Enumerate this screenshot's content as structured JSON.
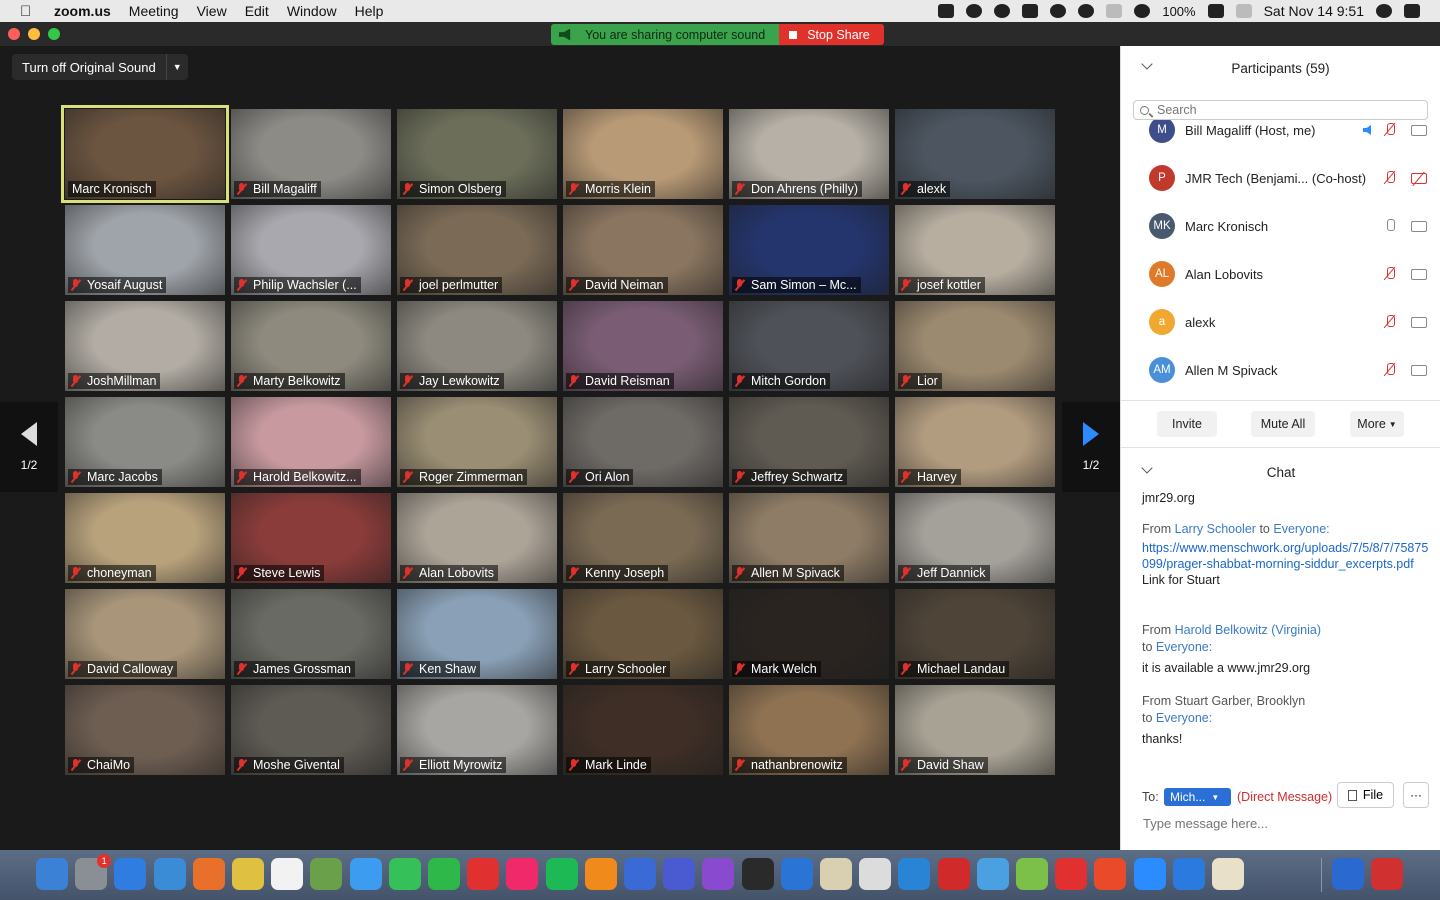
{
  "menubar": {
    "app": "zoom.us",
    "items": [
      "Meeting",
      "View",
      "Edit",
      "Window",
      "Help"
    ],
    "battery": "100%",
    "datetime": "Sat Nov 14  9:51"
  },
  "banner": {
    "sound": "You are sharing computer sound",
    "stop": "Stop Share"
  },
  "toolbar": {
    "original_sound": "Turn off Original Sound"
  },
  "pager": {
    "left": "1/2",
    "right": "1/2"
  },
  "tiles": [
    {
      "name": "Marc Kronisch",
      "muted": false,
      "active": true,
      "bg": "#6b5440"
    },
    {
      "name": "Bill Magaliff",
      "muted": true,
      "bg": "#8d8b86"
    },
    {
      "name": "Simon Olsberg",
      "muted": true,
      "bg": "#6c6e5a"
    },
    {
      "name": "Morris Klein",
      "muted": true,
      "bg": "#b89a76"
    },
    {
      "name": "Don Ahrens (Philly)",
      "muted": true,
      "bg": "#b6b0a6"
    },
    {
      "name": "alexk",
      "muted": true,
      "bg": "#4c5560"
    },
    {
      "name": "Yosaif August",
      "muted": true,
      "bg": "#9fa4aa"
    },
    {
      "name": "Philip Wachsler (...",
      "muted": true,
      "bg": "#a8a8ae"
    },
    {
      "name": "joel perlmutter",
      "muted": true,
      "bg": "#7a6a56"
    },
    {
      "name": "David Neiman",
      "muted": true,
      "bg": "#8a7560"
    },
    {
      "name": "Sam Simon – Mc...",
      "muted": true,
      "bg": "#24356e"
    },
    {
      "name": "josef kottler",
      "muted": true,
      "bg": "#b7aea0"
    },
    {
      "name": "JoshMillman",
      "muted": true,
      "bg": "#b2aca4"
    },
    {
      "name": "Marty Belkowitz",
      "muted": true,
      "bg": "#8e8a7e"
    },
    {
      "name": "Jay Lewkowitz",
      "muted": true,
      "bg": "#8d8980"
    },
    {
      "name": "David Reisman",
      "muted": true,
      "bg": "#7a5d74"
    },
    {
      "name": "Mitch Gordon",
      "muted": true,
      "bg": "#4e5158"
    },
    {
      "name": "Lior",
      "muted": true,
      "bg": "#9c8a70"
    },
    {
      "name": "Marc Jacobs",
      "muted": true,
      "bg": "#8a8a86"
    },
    {
      "name": "Harold Belkowitz...",
      "muted": true,
      "bg": "#c89aa0"
    },
    {
      "name": "Roger Zimmerman",
      "muted": true,
      "bg": "#9a8e74"
    },
    {
      "name": "Ori Alon",
      "muted": true,
      "bg": "#6e6a66"
    },
    {
      "name": "Jeffrey Schwartz",
      "muted": true,
      "bg": "#5f5a52"
    },
    {
      "name": "Harvey",
      "muted": true,
      "bg": "#b29c80"
    },
    {
      "name": "choneyman",
      "muted": true,
      "bg": "#b8a27c"
    },
    {
      "name": "Steve Lewis",
      "muted": true,
      "bg": "#8a3c3a"
    },
    {
      "name": "Alan Lobovits",
      "muted": true,
      "bg": "#ada498"
    },
    {
      "name": "Kenny Joseph",
      "muted": true,
      "bg": "#7a6a54"
    },
    {
      "name": "Allen M Spivack",
      "muted": true,
      "bg": "#8e7c66"
    },
    {
      "name": "Jeff Dannick",
      "muted": true,
      "bg": "#a4a09a"
    },
    {
      "name": "David Calloway",
      "muted": true,
      "bg": "#a8957a"
    },
    {
      "name": "James Grossman",
      "muted": true,
      "bg": "#6a6a64"
    },
    {
      "name": "Ken Shaw",
      "muted": true,
      "bg": "#8aa0b6"
    },
    {
      "name": "Larry Schooler",
      "muted": true,
      "bg": "#6a5840"
    },
    {
      "name": "Mark Welch",
      "muted": true,
      "bg": "#2a2420"
    },
    {
      "name": "Michael Landau",
      "muted": true,
      "bg": "#4e4438"
    },
    {
      "name": "ChaiMo",
      "muted": true,
      "bg": "#6e5e52"
    },
    {
      "name": "Moshe Givental",
      "muted": true,
      "bg": "#5e5a54"
    },
    {
      "name": "Elliott Myrowitz",
      "muted": true,
      "bg": "#a8a6a2"
    },
    {
      "name": "Mark Linde",
      "muted": true,
      "bg": "#3e2e26"
    },
    {
      "name": "nathanbrenowitz",
      "muted": true,
      "bg": "#8e7252"
    },
    {
      "name": "David Shaw",
      "muted": true,
      "bg": "#a8a294"
    }
  ],
  "participants": {
    "title": "Participants (59)",
    "search_placeholder": "Search",
    "list": [
      {
        "initials": "M",
        "name": "Bill Magaliff (Host, me)",
        "color": "#3d4e8a",
        "mic": "muted",
        "cam": "on",
        "speaking": true
      },
      {
        "initials": "P",
        "name": "JMR Tech (Benjami...  (Co-host)",
        "color": "#c0392b",
        "mic": "muted",
        "cam": "off"
      },
      {
        "initials": "MK",
        "name": "Marc Kronisch",
        "color": "#4a5a6e",
        "mic": "on",
        "cam": "on"
      },
      {
        "initials": "AL",
        "name": "Alan Lobovits",
        "color": "#e07a2a",
        "mic": "muted",
        "cam": "on"
      },
      {
        "initials": "a",
        "name": "alexk",
        "color": "#f0a830",
        "mic": "muted",
        "cam": "on"
      },
      {
        "initials": "AM",
        "name": "Allen M Spivack",
        "color": "#4a90d9",
        "mic": "muted",
        "cam": "on"
      }
    ],
    "buttons": {
      "invite": "Invite",
      "mute_all": "Mute All",
      "more": "More"
    }
  },
  "chat": {
    "title": "Chat",
    "messages": [
      {
        "from_label": "",
        "sender": "",
        "to_label": "",
        "to": "",
        "link": "",
        "text": "jmr29.org"
      },
      {
        "from_label": "From",
        "sender": "Larry Schooler",
        "to_label": "to",
        "to": "Everyone:",
        "link": "https://www.menschwork.org/uploads/7/5/8/7/75875099/prager-shabbat-morning-siddur_excerpts.pdf",
        "text": "Link for Stuart"
      },
      {
        "from_label": "From",
        "sender": "Harold Belkowitz (Virginia)",
        "to_label": "to",
        "to": "Everyone:",
        "link": "",
        "text": "it is available a www.jmr29.org"
      },
      {
        "from_label": "From Stuart Garber, Brooklyn",
        "sender": "",
        "to_label": "to",
        "to": "Everyone:",
        "link": "",
        "text": "thanks!"
      }
    ],
    "to_label": "To:",
    "to_value": "Mich...",
    "dm_label": "(Direct Message)",
    "file_button": "File",
    "more_button": "···",
    "input_placeholder": "Type message here..."
  },
  "dock": {
    "colors": [
      "#3b82d6",
      "#8a8f96",
      "#2f7de0",
      "#3a8cd6",
      "#e8702a",
      "#e0c040",
      "#f2f2f2",
      "#6aa04a",
      "#3c9cf0",
      "#36c05a",
      "#2fb84a",
      "#e03030",
      "#f02a6a",
      "#1db954",
      "#f08a1a",
      "#3a6ad6",
      "#4a5ad0",
      "#8a4ad0",
      "#2a2a2a",
      "#2a74d6",
      "#d8d0b0",
      "#dcdcdc",
      "#2a84d6",
      "#d02a2a",
      "#4aa0e0",
      "#7cc04a",
      "#e03030",
      "#e84a2a",
      "#2a8cff",
      "#2a7ae0",
      "#e8e0c8",
      "#2a6ad0",
      "#d03030"
    ],
    "badge": "1"
  }
}
